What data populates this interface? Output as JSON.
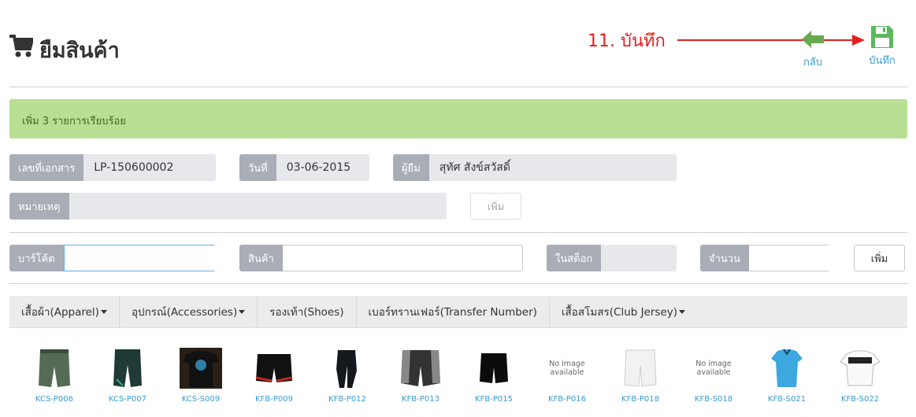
{
  "header": {
    "title": "ยืมสินค้า",
    "annotation": "11. บันทึก",
    "back_label": "กลับ",
    "save_label": "บันทึก"
  },
  "alert": {
    "message": "เพิ่ม 3 รายการเรียบร้อย"
  },
  "form": {
    "doc_no": {
      "label": "เลขที่เอกสาร",
      "value": "LP-150600002"
    },
    "date": {
      "label": "วันที่",
      "value": "03-06-2015"
    },
    "borrower": {
      "label": "ผู้ยืม",
      "value": "สุทัศ สังข์สวัสดิ์"
    },
    "note": {
      "label": "หมายเหตุ",
      "value": ""
    },
    "add_label": "เพิ่ม"
  },
  "search": {
    "barcode": {
      "label": "บาร์โค้ด",
      "value": ""
    },
    "product": {
      "label": "สินค้า",
      "value": ""
    },
    "in_stock": {
      "label": "ในสต็อก",
      "value": ""
    },
    "quantity": {
      "label": "จำนวน",
      "value": ""
    },
    "add_label": "เพิ่ม"
  },
  "tabs": [
    {
      "label": "เสื้อผ้า(Apparel)",
      "dropdown": true
    },
    {
      "label": "อุปกรณ์(Accessories)",
      "dropdown": true
    },
    {
      "label": "รองเท้า(Shoes)",
      "dropdown": false
    },
    {
      "label": "เบอร์ทรานเฟอร์(Transfer Number)",
      "dropdown": false
    },
    {
      "label": "เสื้อสโมสร(Club Jersey)",
      "dropdown": true
    }
  ],
  "products": [
    {
      "code": "KCS-P006",
      "image": "green-shorts"
    },
    {
      "code": "KCS-P007",
      "image": "dark-shorts"
    },
    {
      "code": "KCS-S009",
      "image": "black-tshirt"
    },
    {
      "code": "KFB-P009",
      "image": "black-red-shorts"
    },
    {
      "code": "KFB-P012",
      "image": "black-pants"
    },
    {
      "code": "KFB-P013",
      "image": "grey-shorts"
    },
    {
      "code": "KFB-P015",
      "image": "black-shorts"
    },
    {
      "code": "KFB-P016",
      "image": "no-image",
      "no_image_text": "No image available"
    },
    {
      "code": "KFB-P018",
      "image": "white-shorts"
    },
    {
      "code": "KFB-S018",
      "image": "no-image",
      "no_image_text": "No image available"
    },
    {
      "code": "KFB-S021",
      "image": "blue-jersey"
    },
    {
      "code": "KFB-S022",
      "image": "white-jersey"
    }
  ],
  "colors": {
    "alert_bg": "#b8df92",
    "addon_bg": "#a9adb6",
    "link": "#3a9bd5",
    "save_green": "#5cb85c",
    "annotation_red": "#e02020"
  }
}
